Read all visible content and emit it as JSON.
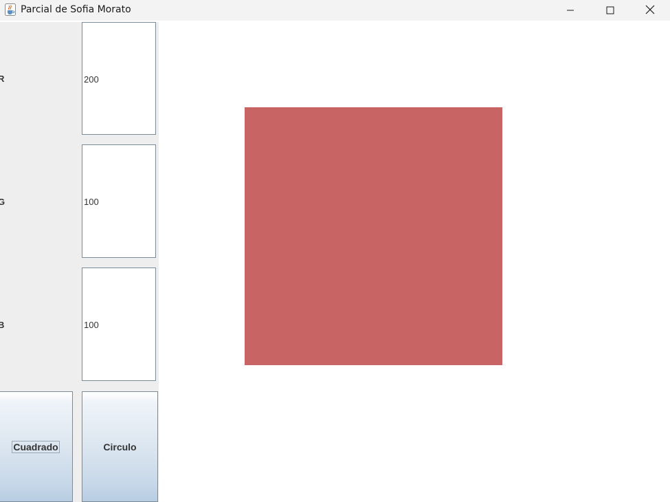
{
  "window": {
    "title": "Parcial de Sofia Morato",
    "app_icon": "java-cup-icon",
    "controls": [
      "minimize-icon",
      "maximize-icon",
      "close-icon"
    ]
  },
  "controls": {
    "r_label": "R",
    "r_value": "200",
    "g_label": "G",
    "g_value": "100",
    "b_label": "B",
    "b_value": "100",
    "square_button": "Cuadrado",
    "circle_button": "Circulo"
  },
  "canvas": {
    "shape": "square",
    "fill_color": "#c86464"
  }
}
